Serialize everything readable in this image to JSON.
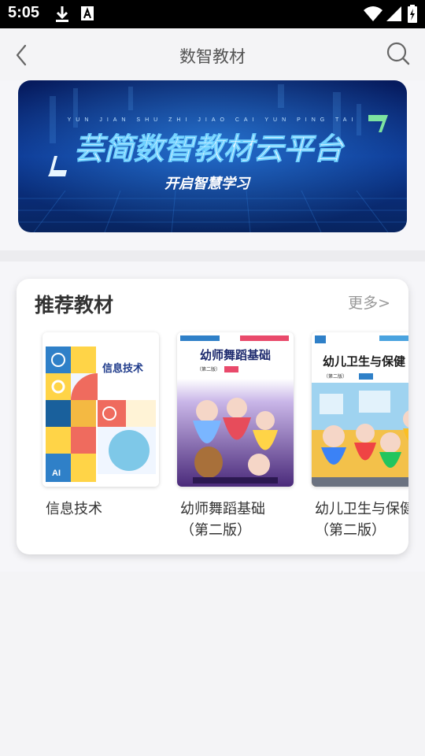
{
  "status_bar": {
    "time": "5:05"
  },
  "header": {
    "title": "数智教材"
  },
  "banner": {
    "pinyin": "YUN JIAN SHU ZHI JIAO CAI YUN PING TAI",
    "title": "芸简数智教材云平台",
    "subtitle": "开启智慧学习"
  },
  "recommend": {
    "title": "推荐教材",
    "more": "更多>",
    "books": [
      {
        "title": "信息技术",
        "subtitle": "",
        "cover_title": "信息技术"
      },
      {
        "title": "幼师舞蹈基础",
        "subtitle": "（第二版）",
        "cover_title": "幼师舞蹈基础",
        "cover_edition": "（第二版）"
      },
      {
        "title": "幼儿卫生与保健",
        "subtitle": "（第二版）",
        "cover_title": "幼儿卫生与保健",
        "cover_edition": "（第二版）"
      }
    ]
  },
  "colors": {
    "banner_bg": "#0a1f6b",
    "accent_green": "#7de3a0",
    "status_bar": "#000000"
  }
}
